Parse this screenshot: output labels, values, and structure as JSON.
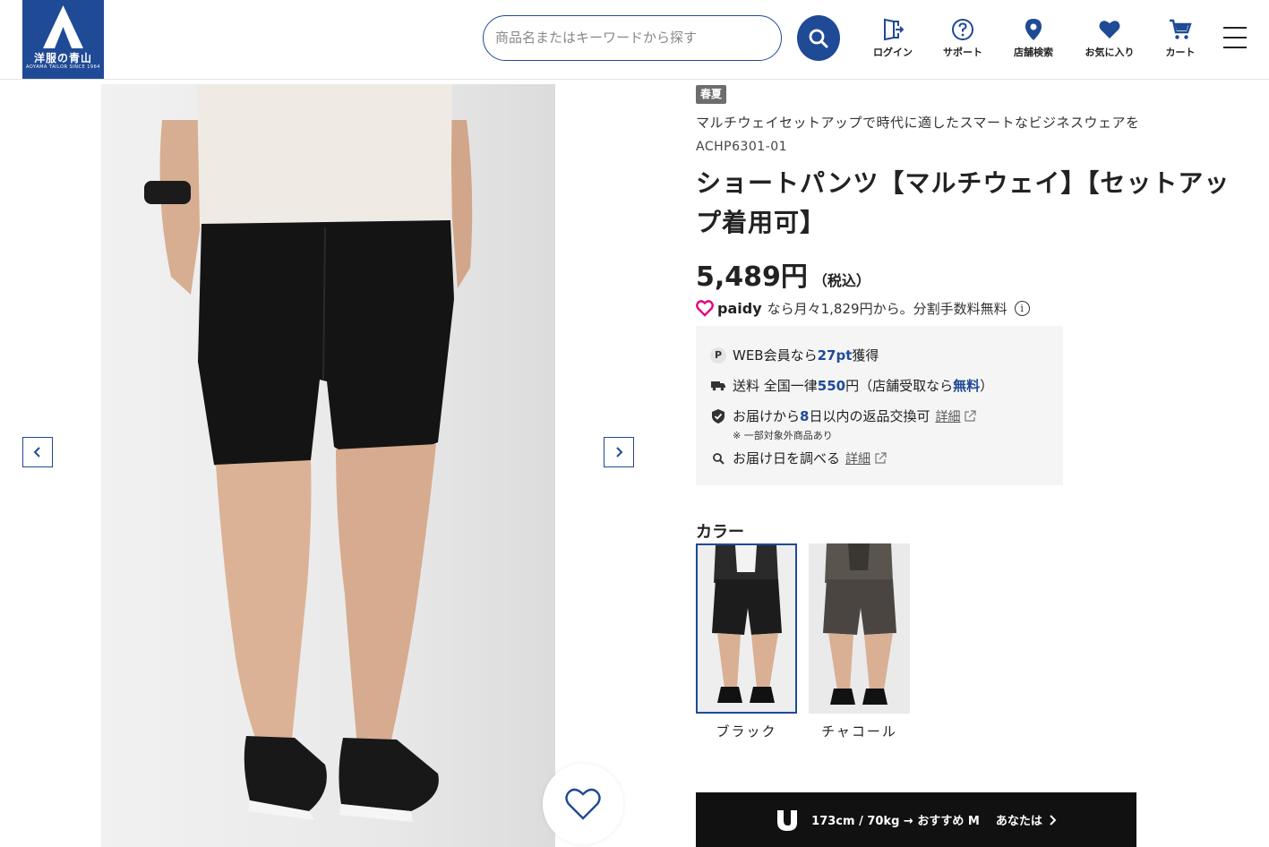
{
  "brand": {
    "logo_text": "洋服の青山",
    "logo_sub": "AOYAMA TAILOR SINCE 1964"
  },
  "search": {
    "placeholder": "商品名またはキーワードから探す"
  },
  "nav": {
    "login": "ログイン",
    "support": "サポート",
    "stores": "店舗検索",
    "favorites": "お気に入り",
    "cart": "カート"
  },
  "product": {
    "season": "春夏",
    "catch_copy": "マルチウェイセットアップで時代に適したスマートなビジネスウェアを",
    "code": "ACHP6301-01",
    "title": "ショートパンツ【マルチウェイ】【セットアップ着用可】",
    "price": "5,489円",
    "tax_note": "（税込）"
  },
  "paidy": {
    "brand": "paidy",
    "text": "なら月々1,829円から。分割手数料無料",
    "info": "i"
  },
  "benefits": {
    "points_icon": "P",
    "points_prefix": "WEB会員なら",
    "points_value": "27pt",
    "points_suffix": "獲得",
    "shipping_prefix": "送料 全国一律",
    "shipping_value": "550",
    "shipping_mid": "円（店舗受取なら",
    "shipping_free": "無料",
    "shipping_suffix": "）",
    "return_prefix": "お届けから ",
    "return_days": "8",
    "return_suffix": " 日以内の返品交換可",
    "return_link": "詳細",
    "return_note": "※ 一部対象外商品あり",
    "delivery_text": "お届け日を調べる",
    "delivery_link": "詳細"
  },
  "colors": {
    "heading": "カラー",
    "options": [
      {
        "label": "ブラック",
        "swatch": "#1c1c1c",
        "selected": true
      },
      {
        "label": "チャコール",
        "swatch": "#4a4540",
        "selected": false
      }
    ]
  },
  "fit": {
    "recommendation": "173cm / 70kg → おすすめ M",
    "you": "あなたは"
  },
  "theme": {
    "primary": "#1f4a96",
    "paidy": "#e5007f"
  }
}
